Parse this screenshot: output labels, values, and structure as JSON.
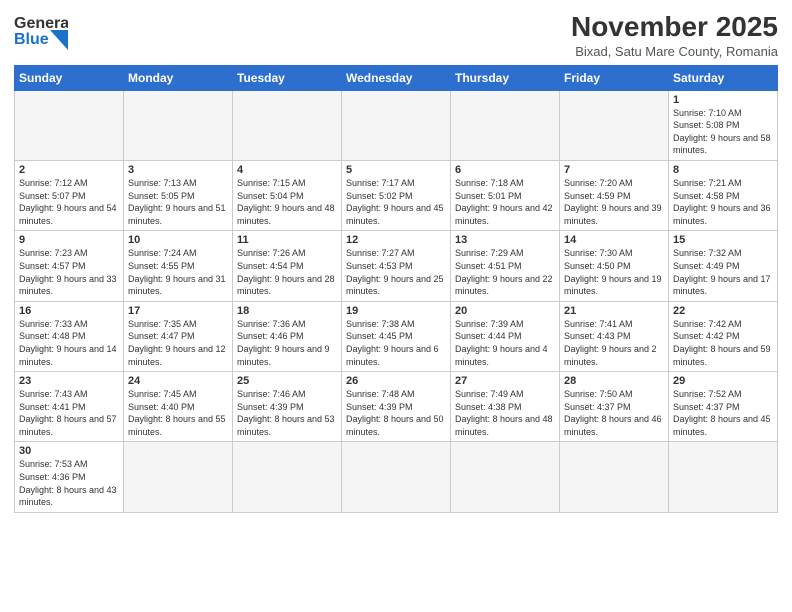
{
  "header": {
    "logo_line1": "General",
    "logo_line2": "Blue",
    "title": "November 2025",
    "subtitle": "Bixad, Satu Mare County, Romania"
  },
  "days_of_week": [
    "Sunday",
    "Monday",
    "Tuesday",
    "Wednesday",
    "Thursday",
    "Friday",
    "Saturday"
  ],
  "weeks": [
    [
      {
        "day": "",
        "info": ""
      },
      {
        "day": "",
        "info": ""
      },
      {
        "day": "",
        "info": ""
      },
      {
        "day": "",
        "info": ""
      },
      {
        "day": "",
        "info": ""
      },
      {
        "day": "",
        "info": ""
      },
      {
        "day": "1",
        "info": "Sunrise: 7:10 AM\nSunset: 5:08 PM\nDaylight: 9 hours\nand 58 minutes."
      }
    ],
    [
      {
        "day": "2",
        "info": "Sunrise: 7:12 AM\nSunset: 5:07 PM\nDaylight: 9 hours\nand 54 minutes."
      },
      {
        "day": "3",
        "info": "Sunrise: 7:13 AM\nSunset: 5:05 PM\nDaylight: 9 hours\nand 51 minutes."
      },
      {
        "day": "4",
        "info": "Sunrise: 7:15 AM\nSunset: 5:04 PM\nDaylight: 9 hours\nand 48 minutes."
      },
      {
        "day": "5",
        "info": "Sunrise: 7:17 AM\nSunset: 5:02 PM\nDaylight: 9 hours\nand 45 minutes."
      },
      {
        "day": "6",
        "info": "Sunrise: 7:18 AM\nSunset: 5:01 PM\nDaylight: 9 hours\nand 42 minutes."
      },
      {
        "day": "7",
        "info": "Sunrise: 7:20 AM\nSunset: 4:59 PM\nDaylight: 9 hours\nand 39 minutes."
      },
      {
        "day": "8",
        "info": "Sunrise: 7:21 AM\nSunset: 4:58 PM\nDaylight: 9 hours\nand 36 minutes."
      }
    ],
    [
      {
        "day": "9",
        "info": "Sunrise: 7:23 AM\nSunset: 4:57 PM\nDaylight: 9 hours\nand 33 minutes."
      },
      {
        "day": "10",
        "info": "Sunrise: 7:24 AM\nSunset: 4:55 PM\nDaylight: 9 hours\nand 31 minutes."
      },
      {
        "day": "11",
        "info": "Sunrise: 7:26 AM\nSunset: 4:54 PM\nDaylight: 9 hours\nand 28 minutes."
      },
      {
        "day": "12",
        "info": "Sunrise: 7:27 AM\nSunset: 4:53 PM\nDaylight: 9 hours\nand 25 minutes."
      },
      {
        "day": "13",
        "info": "Sunrise: 7:29 AM\nSunset: 4:51 PM\nDaylight: 9 hours\nand 22 minutes."
      },
      {
        "day": "14",
        "info": "Sunrise: 7:30 AM\nSunset: 4:50 PM\nDaylight: 9 hours\nand 19 minutes."
      },
      {
        "day": "15",
        "info": "Sunrise: 7:32 AM\nSunset: 4:49 PM\nDaylight: 9 hours\nand 17 minutes."
      }
    ],
    [
      {
        "day": "16",
        "info": "Sunrise: 7:33 AM\nSunset: 4:48 PM\nDaylight: 9 hours\nand 14 minutes."
      },
      {
        "day": "17",
        "info": "Sunrise: 7:35 AM\nSunset: 4:47 PM\nDaylight: 9 hours\nand 12 minutes."
      },
      {
        "day": "18",
        "info": "Sunrise: 7:36 AM\nSunset: 4:46 PM\nDaylight: 9 hours\nand 9 minutes."
      },
      {
        "day": "19",
        "info": "Sunrise: 7:38 AM\nSunset: 4:45 PM\nDaylight: 9 hours\nand 6 minutes."
      },
      {
        "day": "20",
        "info": "Sunrise: 7:39 AM\nSunset: 4:44 PM\nDaylight: 9 hours\nand 4 minutes."
      },
      {
        "day": "21",
        "info": "Sunrise: 7:41 AM\nSunset: 4:43 PM\nDaylight: 9 hours\nand 2 minutes."
      },
      {
        "day": "22",
        "info": "Sunrise: 7:42 AM\nSunset: 4:42 PM\nDaylight: 8 hours\nand 59 minutes."
      }
    ],
    [
      {
        "day": "23",
        "info": "Sunrise: 7:43 AM\nSunset: 4:41 PM\nDaylight: 8 hours\nand 57 minutes."
      },
      {
        "day": "24",
        "info": "Sunrise: 7:45 AM\nSunset: 4:40 PM\nDaylight: 8 hours\nand 55 minutes."
      },
      {
        "day": "25",
        "info": "Sunrise: 7:46 AM\nSunset: 4:39 PM\nDaylight: 8 hours\nand 53 minutes."
      },
      {
        "day": "26",
        "info": "Sunrise: 7:48 AM\nSunset: 4:39 PM\nDaylight: 8 hours\nand 50 minutes."
      },
      {
        "day": "27",
        "info": "Sunrise: 7:49 AM\nSunset: 4:38 PM\nDaylight: 8 hours\nand 48 minutes."
      },
      {
        "day": "28",
        "info": "Sunrise: 7:50 AM\nSunset: 4:37 PM\nDaylight: 8 hours\nand 46 minutes."
      },
      {
        "day": "29",
        "info": "Sunrise: 7:52 AM\nSunset: 4:37 PM\nDaylight: 8 hours\nand 45 minutes."
      }
    ],
    [
      {
        "day": "30",
        "info": "Sunrise: 7:53 AM\nSunset: 4:36 PM\nDaylight: 8 hours\nand 43 minutes."
      },
      {
        "day": "",
        "info": ""
      },
      {
        "day": "",
        "info": ""
      },
      {
        "day": "",
        "info": ""
      },
      {
        "day": "",
        "info": ""
      },
      {
        "day": "",
        "info": ""
      },
      {
        "day": "",
        "info": ""
      }
    ]
  ]
}
